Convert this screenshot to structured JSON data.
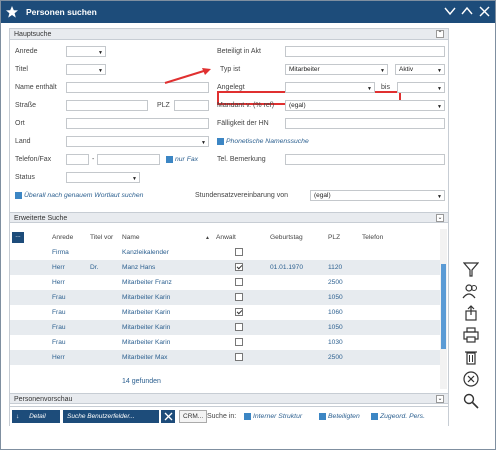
{
  "window": {
    "title": "Personen suchen"
  },
  "hauptsuche": {
    "header": "Hauptsuche",
    "anrede_label": "Anrede",
    "titel_label": "Titel",
    "name_enthaelt_label": "Name enthält",
    "strasse_label": "Straße",
    "plz_label": "PLZ",
    "ort_label": "Ort",
    "land_label": "Land",
    "telefon_label": "Telefon/Fax",
    "tel_sep": "-",
    "nur_fax_label": "nur Fax",
    "status_label": "Status",
    "ueberall_label": "Überall nach genauem Wortlaut suchen",
    "beteiligt_label": "Beteiligt in Akt",
    "typ_ist_label": "Typ ist",
    "typ_ist_value": "Mitarbeiter",
    "typ_status_value": "Aktiv",
    "angelegt_label": "Angelegt",
    "bis_label": "bis",
    "mandant_label": "Mandant v. (% ref)",
    "mandant_value": "(egal)",
    "faelligkeit_label": "Fälligkeit der HN",
    "phonetisch_label": "Phonetische Namenssuche",
    "tel_bemerkung_label": "Tel. Bemerkung",
    "stundensatz_label": "Stundensatzvereinbarung von",
    "stundensatz_value": "(egal)"
  },
  "erweiterte": {
    "header": "Erweiterte Suche"
  },
  "grid": {
    "menu_label": "...",
    "columns": {
      "anrede": "Anrede",
      "titel": "Titel vor",
      "name": "Name",
      "anwalt": "Anwalt",
      "geburtstag": "Geburtstag",
      "plz": "PLZ",
      "telefon": "Telefon"
    },
    "sort_icon": "▲",
    "rows": [
      {
        "anrede": "Firma",
        "titel": "",
        "name": "Kanzleikalender",
        "anwalt": false,
        "geburtstag": "",
        "plz": ""
      },
      {
        "anrede": "Herr",
        "titel": "Dr.",
        "name": "Manz Hans",
        "anwalt": true,
        "geburtstag": "01.01.1970",
        "plz": "1120"
      },
      {
        "anrede": "Herr",
        "titel": "",
        "name": "Mitarbeiter Franz",
        "anwalt": false,
        "geburtstag": "",
        "plz": "2500"
      },
      {
        "anrede": "Frau",
        "titel": "",
        "name": "Mitarbeiter Karin",
        "anwalt": false,
        "geburtstag": "",
        "plz": "1050"
      },
      {
        "anrede": "Frau",
        "titel": "",
        "name": "Mitarbeiter Karin",
        "anwalt": true,
        "geburtstag": "",
        "plz": "1060"
      },
      {
        "anrede": "Frau",
        "titel": "",
        "name": "Mitarbeiter Karin",
        "anwalt": false,
        "geburtstag": "",
        "plz": "1050"
      },
      {
        "anrede": "Frau",
        "titel": "",
        "name": "Mitarbeiter Karin",
        "anwalt": false,
        "geburtstag": "",
        "plz": "1030"
      },
      {
        "anrede": "Herr",
        "titel": "",
        "name": "Mitarbeiter Max",
        "anwalt": false,
        "geburtstag": "",
        "plz": "2500"
      }
    ],
    "count_text": "14 gefunden"
  },
  "vorschau": {
    "header": "Personenvorschau"
  },
  "footer": {
    "detail_label": "Detail",
    "suche_benutzer_label": "Suche Benutzerfelder...",
    "crm_label": "CRM...",
    "suche_in_label": "Suche in:",
    "interne_label": "Interner Struktur",
    "beteiligten_label": "Beteiligten",
    "zugeord_label": "Zugeord. Pers."
  },
  "colors": {
    "titlebar": "#1d4c7a",
    "accent": "#3c86c4",
    "highlight": "#e03030"
  }
}
